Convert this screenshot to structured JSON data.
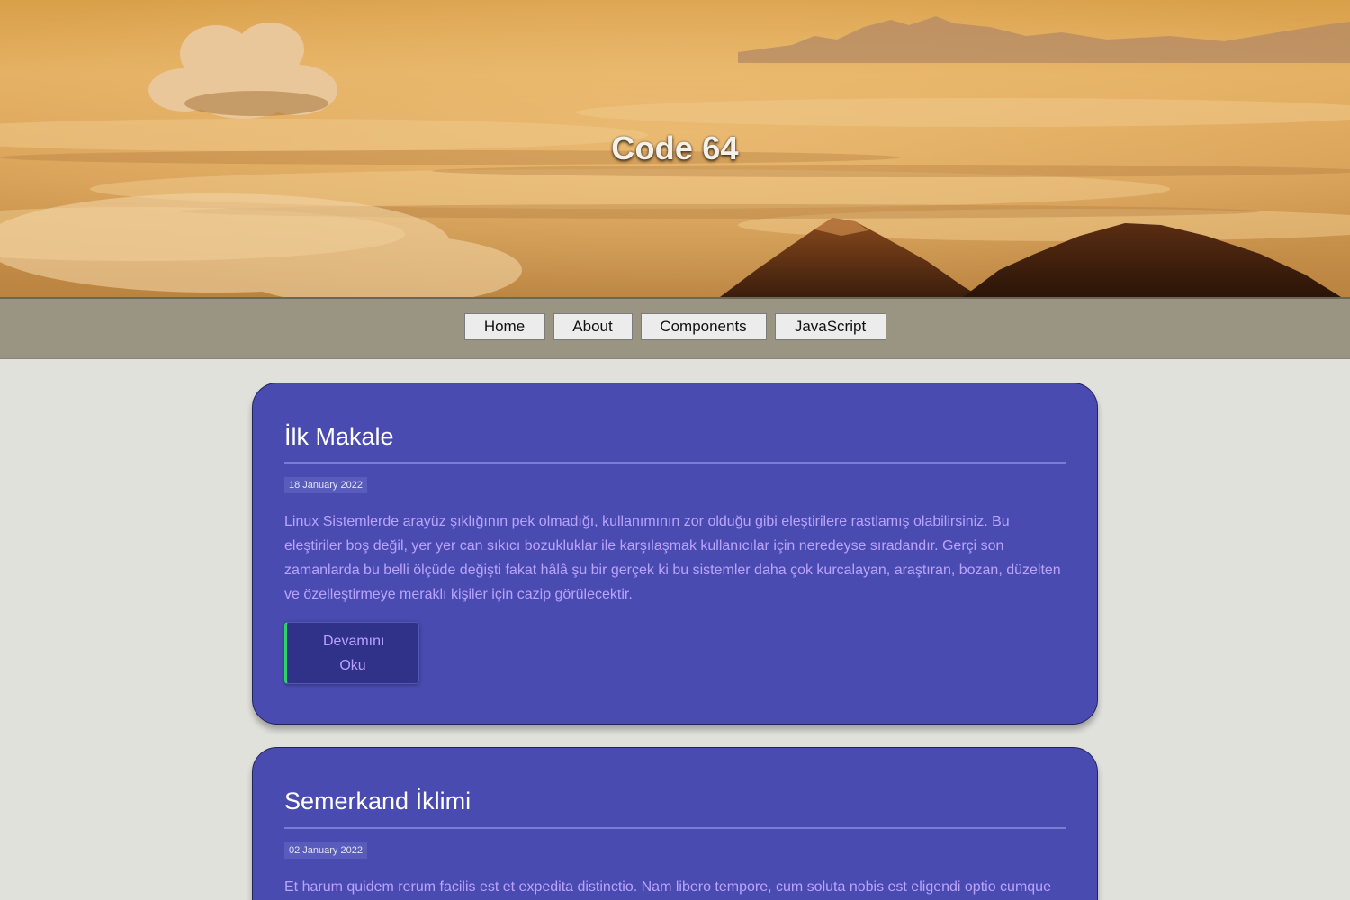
{
  "site": {
    "title": "Code 64"
  },
  "nav": {
    "items": [
      {
        "label": "Home"
      },
      {
        "label": "About"
      },
      {
        "label": "Components"
      },
      {
        "label": "JavaScript"
      }
    ]
  },
  "articles": [
    {
      "title": "İlk Makale",
      "date": "18 January 2022",
      "text": "Linux Sistemlerde arayüz şıklığının pek olmadığı, kullanımının zor olduğu gibi eleştirilere rastlamış olabilirsiniz. Bu eleştiriler boş değil, yer yer can sıkıcı bozukluklar ile karşılaşmak kullanıcılar için neredeyse sıradandır. Gerçi son zamanlarda bu belli ölçüde değişti fakat hâlâ şu bir gerçek ki bu sistemler daha çok kurcalayan, araştıran, bozan, düzelten ve özelleştirmeye meraklı kişiler için cazip görülecektir.",
      "button": "Devamını Oku"
    },
    {
      "title": "Semerkand İklimi",
      "date": "02 January 2022",
      "text": "Et harum quidem rerum facilis est et expedita distinctio. Nam libero tempore, cum soluta nobis est eligendi optio cumque"
    }
  ],
  "colors": {
    "card_bg": "#4a4bb0",
    "card_text": "#b9a3ff",
    "nav_bg": "#9a9483",
    "page_bg": "#e1e1dc",
    "button_bg": "#2f3288",
    "button_accent": "#2dd36a"
  }
}
